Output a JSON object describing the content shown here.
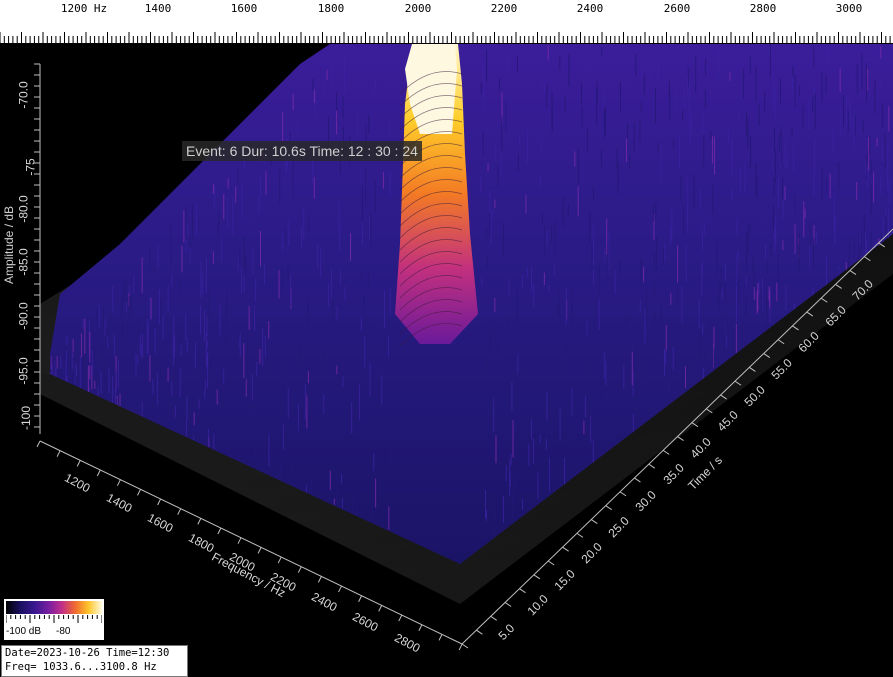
{
  "top_scale": {
    "labels": [
      "1200 Hz",
      "1400",
      "1600",
      "1800",
      "2000",
      "2200",
      "2400",
      "2600",
      "2800",
      "3000"
    ]
  },
  "event_overlay": {
    "text": "Event: 6  Dur: 10.6s  Time: 12 : 30 : 24"
  },
  "amplitude_axis": {
    "label": "Amplitude / dB",
    "ticks": [
      "-70.0",
      "-75",
      "-80.0",
      "-85.0",
      "-90.0",
      "-95.0",
      "-100"
    ]
  },
  "frequency_axis": {
    "label": "Frequency / Hz",
    "ticks": [
      "1200",
      "1400",
      "1600",
      "1800",
      "2000",
      "2200",
      "2400",
      "2600",
      "2800"
    ]
  },
  "time_axis": {
    "label": "Time / s",
    "ticks": [
      "5.0",
      "10.0",
      "15.0",
      "20.0",
      "25.0",
      "30.0",
      "35.0",
      "40.0",
      "45.0",
      "50.0",
      "55.0",
      "60.0",
      "65.0",
      "70.0"
    ]
  },
  "colorbar": {
    "min_label": "-100 dB",
    "max_label": "-80"
  },
  "info_box": {
    "line1": "Date=2023-10-26 Time=12:30",
    "line2": "Freq= 1033.6...3100.8 Hz"
  },
  "colors": {
    "background": "#000000",
    "floor": "#1c1c1c",
    "noise_low": "#1e1670",
    "noise_high": "#7a2aa8",
    "peak_mid": "#f07a20",
    "peak_high": "#ffd52a",
    "peak_top": "#ffffff"
  }
}
